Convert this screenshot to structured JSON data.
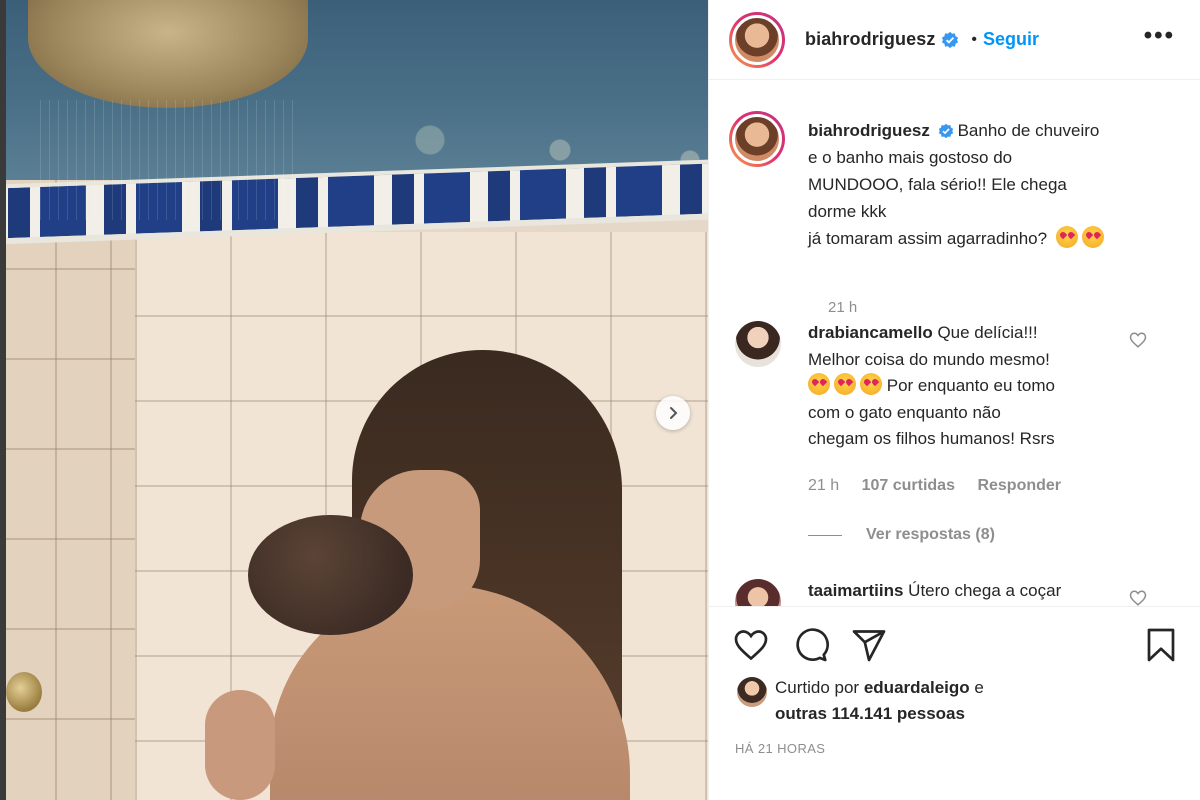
{
  "header": {
    "username": "biahrodriguesz",
    "separator": "•",
    "follow_label": "Seguir",
    "more_label": "•••"
  },
  "post": {
    "next_icon": "chevron-right-icon",
    "caption": {
      "username": "biahrodriguesz",
      "lines": [
        "Banho de chuveiro",
        "e o banho mais gostoso do",
        "MUNDOOO, fala sério!! Ele chega",
        "dorme kkk",
        "já tomaram assim agarradinho?"
      ],
      "time": "21 h"
    }
  },
  "comments": [
    {
      "username": "drabiancamello",
      "lines": [
        "Que delícia!!!",
        "Melhor coisa do mundo mesmo!",
        "Por enquanto eu tomo",
        "com o gato enquanto não",
        "chegam os filhos humanos! Rsrs"
      ],
      "time": "21 h",
      "likes": "107 curtidas",
      "reply_label": "Responder",
      "view_replies": "Ver respostas (8)"
    },
    {
      "username": "taaimartiins",
      "text": "Útero chega a coçar"
    }
  ],
  "actions": {
    "like_icon": "heart-icon",
    "comment_icon": "comment-icon",
    "share_icon": "send-icon",
    "save_icon": "bookmark-icon"
  },
  "likes": {
    "prefix": "Curtido por",
    "user": "eduardaleigo",
    "suffix": "e",
    "others": "outras 114.141 pessoas"
  },
  "timestamp": "HÁ 21 HORAS",
  "colors": {
    "link": "#0095f6",
    "muted": "#8e8e8e",
    "text": "#262626",
    "verified": "#3897f0"
  }
}
